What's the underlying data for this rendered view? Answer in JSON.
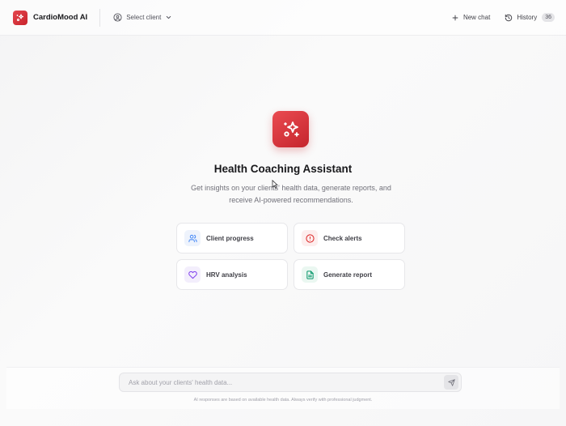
{
  "header": {
    "app_title": "CardioMood AI",
    "logo_icon": "sparkle-icon",
    "client_select_label": "Select client",
    "new_chat_label": "New chat",
    "history_label": "History",
    "history_count": "36"
  },
  "hero": {
    "icon": "sparkles-icon",
    "title": "Health Coaching Assistant",
    "subtitle": "Get insights on your clients' health data, generate reports, and receive AI-powered recommendations."
  },
  "quick_actions": [
    {
      "label": "Client progress",
      "icon": "users-icon",
      "color": "#3b82f6",
      "bg": "#eef3fc"
    },
    {
      "label": "Check alerts",
      "icon": "alert-circle-icon",
      "color": "#dc2626",
      "bg": "#fdeeee"
    },
    {
      "label": "HRV analysis",
      "icon": "heart-icon",
      "color": "#7c3aed",
      "bg": "#f3eefc"
    },
    {
      "label": "Generate report",
      "icon": "file-text-icon",
      "color": "#059669",
      "bg": "#eaf7f1"
    }
  ],
  "chat": {
    "placeholder": "Ask about your clients' health data...",
    "value": "",
    "send_icon": "send-icon",
    "disclaimer": "AI responses are based on available health data. Always verify with professional judgment."
  },
  "colors": {
    "brand": "#d9363e",
    "background": "#f7f7f8"
  }
}
